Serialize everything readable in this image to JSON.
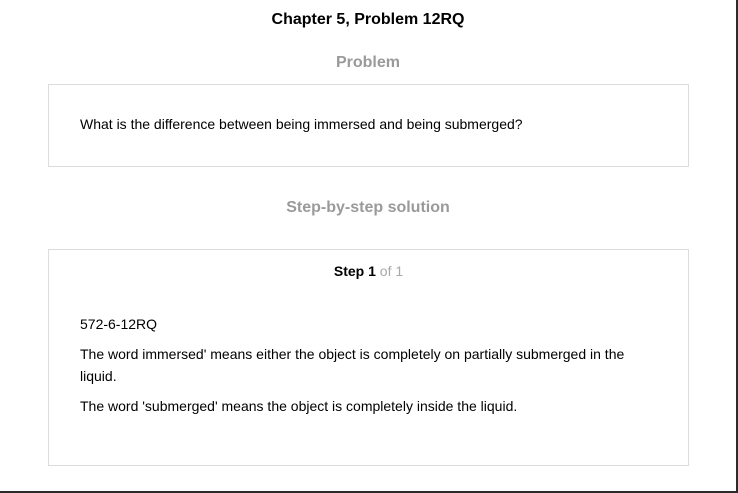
{
  "chapter_title": "Chapter 5, Problem 12RQ",
  "problem": {
    "heading": "Problem",
    "text": "What is the difference between being immersed and being submerged?"
  },
  "solution": {
    "heading": "Step-by-step solution",
    "step": {
      "word": "Step",
      "number": "1",
      "total": "of 1"
    },
    "image_ref": "572-6-12RQ",
    "paragraphs": [
      "The word immersed' means either the object is completely on partially submerged in the liquid.",
      "The word 'submerged' means the object is completely inside the liquid."
    ]
  },
  "colors": {
    "heading_gray": "#9a9a9a",
    "border": "#dcdcdc",
    "step_total_gray": "#a8a8a8"
  }
}
